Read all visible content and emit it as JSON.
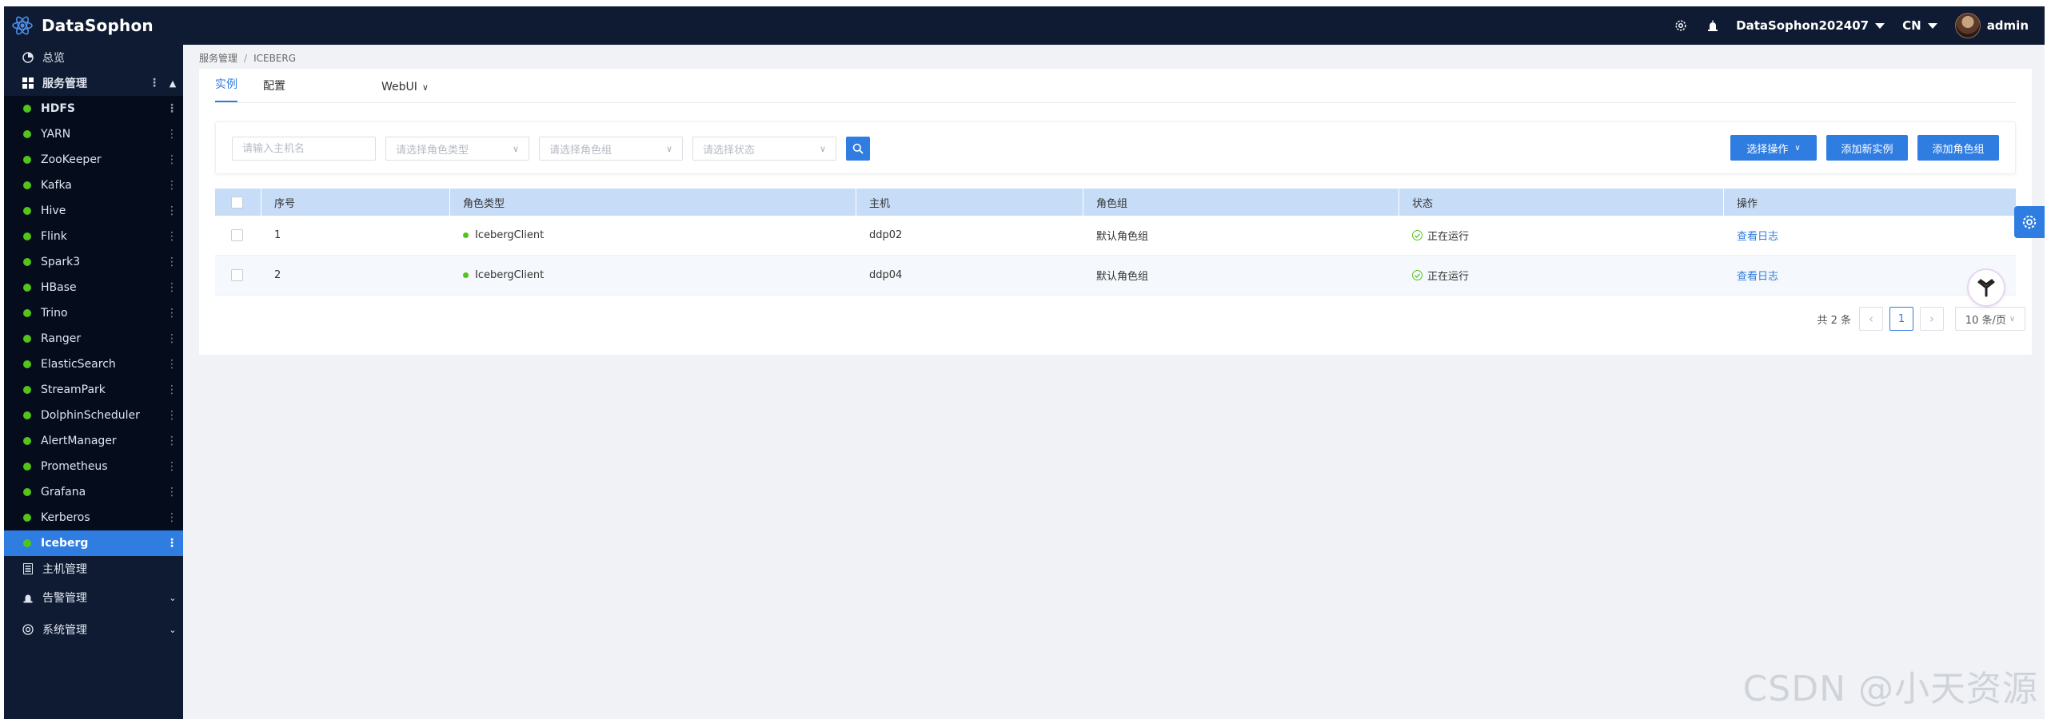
{
  "app": {
    "title": "DataSophon",
    "accent": "#2f7de1",
    "sidebar_bg": "#0f1b33",
    "status_green": "#52c41a"
  },
  "header": {
    "cluster": "DataSophon202407",
    "language": "CN",
    "user": "admin"
  },
  "sidebar": {
    "overview": "总览",
    "service_mgmt": "服务管理",
    "services": [
      {
        "label": "HDFS"
      },
      {
        "label": "YARN"
      },
      {
        "label": "ZooKeeper"
      },
      {
        "label": "Kafka"
      },
      {
        "label": "Hive"
      },
      {
        "label": "Flink"
      },
      {
        "label": "Spark3"
      },
      {
        "label": "HBase"
      },
      {
        "label": "Trino"
      },
      {
        "label": "Ranger"
      },
      {
        "label": "ElasticSearch"
      },
      {
        "label": "StreamPark"
      },
      {
        "label": "DolphinScheduler"
      },
      {
        "label": "AlertManager"
      },
      {
        "label": "Prometheus"
      },
      {
        "label": "Grafana"
      },
      {
        "label": "Kerberos"
      },
      {
        "label": "Iceberg"
      }
    ],
    "host_mgmt": "主机管理",
    "alert_mgmt": "告警管理",
    "system_mgmt": "系统管理"
  },
  "breadcrumb": {
    "parent": "服务管理",
    "sep": "/",
    "current": "ICEBERG"
  },
  "tabs": {
    "instance": "实例",
    "config": "配置",
    "webui": "WebUI"
  },
  "filters": {
    "host_placeholder": "请输入主机名",
    "role_type": "请选择角色类型",
    "role_group": "请选择角色组",
    "status": "请选择状态"
  },
  "actions": {
    "select_op": "选择操作",
    "add_instance": "添加新实例",
    "add_role_group": "添加角色组"
  },
  "table": {
    "headers": [
      "序号",
      "角色类型",
      "主机",
      "角色组",
      "状态",
      "操作"
    ],
    "rows": [
      {
        "no": "1",
        "role": "IcebergClient",
        "host": "ddp02",
        "group": "默认角色组",
        "status": "正在运行",
        "op": "查看日志"
      },
      {
        "no": "2",
        "role": "IcebergClient",
        "host": "ddp04",
        "group": "默认角色组",
        "status": "正在运行",
        "op": "查看日志"
      }
    ]
  },
  "pagination": {
    "total": "共 2 条",
    "current": "1",
    "page_size": "10 条/页"
  },
  "watermark": "CSDN @小天资源"
}
